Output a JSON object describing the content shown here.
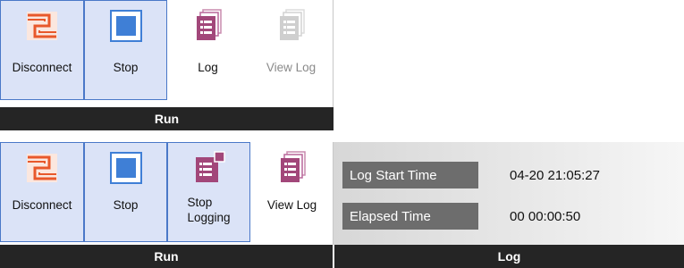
{
  "top_ribbon": {
    "buttons": [
      {
        "label": "Disconnect",
        "icon": "disconnect-icon",
        "active": true
      },
      {
        "label": "Stop",
        "icon": "stop-icon",
        "active": true
      },
      {
        "label": "Log",
        "icon": "log-icon",
        "active": false
      },
      {
        "label": "View Log",
        "icon": "view-log-icon",
        "disabled": true
      }
    ],
    "group_label": "Run"
  },
  "bottom_ribbon": {
    "buttons": [
      {
        "label": "Disconnect",
        "icon": "disconnect-icon",
        "active": true
      },
      {
        "label": "Stop",
        "icon": "stop-icon",
        "active": true
      },
      {
        "label_line1": "Stop",
        "label_line2": "Logging",
        "icon": "stop-logging-icon",
        "active": true
      },
      {
        "label": "View Log",
        "icon": "view-log-icon",
        "active": false
      }
    ],
    "group_label": "Run"
  },
  "log_group": {
    "group_label": "Log",
    "fields": [
      {
        "label": "Log Start Time",
        "value": "04-20 21:05:27"
      },
      {
        "label": "Elapsed Time",
        "value": "00 00:00:50"
      }
    ]
  },
  "colors": {
    "active_bg": "#dbe3f7",
    "active_border": "#4a78c8",
    "group_bar": "#252525",
    "disconnect_icon": "#e8582b",
    "stop_icon": "#3f7fd6",
    "log_icon": "#a2477a",
    "disabled_icon": "#cfcfcf"
  }
}
